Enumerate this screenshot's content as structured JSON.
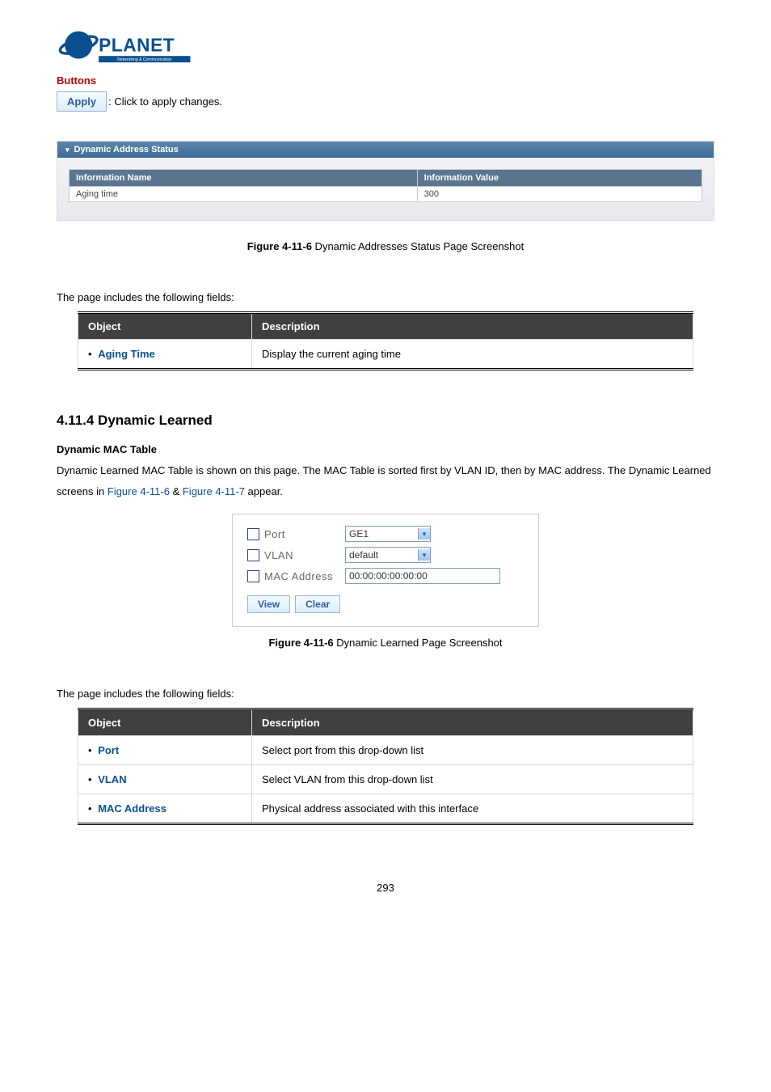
{
  "header": {
    "logo_top": "PLANET",
    "logo_bottom": "Networking & Communication"
  },
  "buttons_section": {
    "heading": "Buttons",
    "apply_label": "Apply",
    "apply_desc": ": Click to apply changes."
  },
  "status_panel": {
    "title": "Dynamic Address Status",
    "col_name": "Information Name",
    "col_value": "Information Value",
    "rows": [
      {
        "name": "Aging time",
        "value": "300"
      }
    ]
  },
  "caption1": {
    "label": "Figure 4-11-6",
    "text": " Dynamic Addresses Status Page Screenshot"
  },
  "intro1": "The page includes the following fields:",
  "table1": {
    "h_object": "Object",
    "h_desc": "Description",
    "rows": [
      {
        "obj": "Aging Time",
        "desc": "Display the current aging time"
      }
    ]
  },
  "section": {
    "heading": "4.11.4 Dynamic Learned",
    "subheading": "Dynamic MAC Table",
    "body_pre": "Dynamic Learned MAC Table is shown on this page. The MAC Table is sorted first by VLAN ID, then by MAC address. The Dynamic Learned screens in ",
    "link1": "Figure 4-11-6",
    "amp": " & ",
    "link2": "Figure 4-11-7",
    "body_post": " appear."
  },
  "form": {
    "port_label": "Port",
    "port_value": "GE1",
    "vlan_label": "VLAN",
    "vlan_value": "default",
    "mac_label": "MAC Address",
    "mac_value": "00:00:00:00:00:00",
    "view_btn": "View",
    "clear_btn": "Clear"
  },
  "caption2": {
    "label": "Figure 4-11-6",
    "text": " Dynamic Learned Page Screenshot"
  },
  "intro2": "The page includes the following fields:",
  "table2": {
    "h_object": "Object",
    "h_desc": "Description",
    "rows": [
      {
        "obj": "Port",
        "desc": "Select port from this drop-down list"
      },
      {
        "obj": "VLAN",
        "desc": "Select VLAN from this drop-down list"
      },
      {
        "obj": "MAC Address",
        "desc": "Physical address associated with this interface"
      }
    ]
  },
  "page_number": "293"
}
